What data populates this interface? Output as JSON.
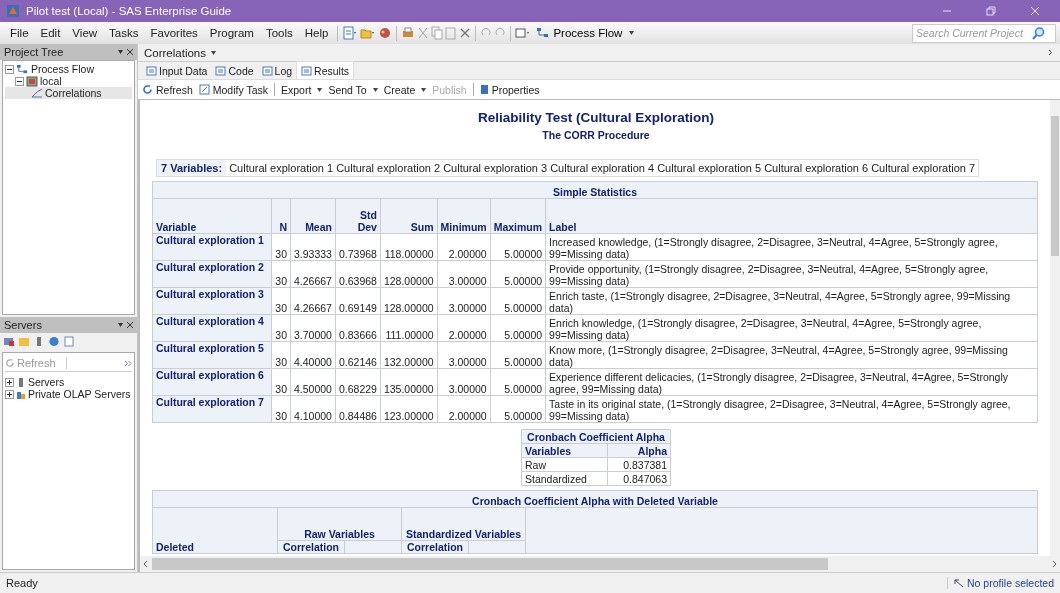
{
  "window": {
    "title": "Pilot test (Local) - SAS Enterprise Guide"
  },
  "menu": [
    "File",
    "Edit",
    "View",
    "Tasks",
    "Favorites",
    "Program",
    "Tools",
    "Help"
  ],
  "process_flow_button": "Process Flow",
  "search": {
    "placeholder": "Search Current Project"
  },
  "project_tree": {
    "title": "Project Tree",
    "items": [
      {
        "label": "Process Flow",
        "kind": "flow",
        "children": [
          {
            "label": "local",
            "kind": "server",
            "children": [
              {
                "label": "Correlations",
                "kind": "task",
                "selected": true
              }
            ]
          }
        ]
      }
    ]
  },
  "servers": {
    "title": "Servers",
    "refresh": "Refresh",
    "items": [
      {
        "label": "Servers",
        "kind": "server"
      },
      {
        "label": "Private OLAP Servers",
        "kind": "olap"
      }
    ]
  },
  "document": {
    "title": "Correlations",
    "tabs": [
      {
        "label": "Input Data",
        "selected": false
      },
      {
        "label": "Code",
        "selected": false
      },
      {
        "label": "Log",
        "selected": false
      },
      {
        "label": "Results",
        "selected": true
      }
    ],
    "actions": [
      {
        "label": "Refresh",
        "kind": "refresh",
        "dropdown": false,
        "disabled": false
      },
      {
        "label": "Modify Task",
        "kind": "modify",
        "dropdown": false,
        "disabled": false
      },
      {
        "label": "Export",
        "kind": "text",
        "dropdown": true,
        "disabled": false
      },
      {
        "label": "Send To",
        "kind": "text",
        "dropdown": true,
        "disabled": false
      },
      {
        "label": "Create",
        "kind": "text",
        "dropdown": true,
        "disabled": false
      },
      {
        "label": "Publish",
        "kind": "text",
        "dropdown": false,
        "disabled": true
      },
      {
        "label": "Properties",
        "kind": "properties",
        "dropdown": false,
        "disabled": false
      }
    ]
  },
  "report": {
    "title": "Reliability Test (Cultural Exploration)",
    "subtitle": "The CORR Procedure",
    "variables_label": "7 Variables:",
    "variables": "Cultural exploration 1 Cultural exploration 2 Cultural exploration 3 Cultural exploration 4 Cultural exploration 5 Cultural exploration 6 Cultural exploration 7",
    "simple_statistics": {
      "title": "Simple Statistics",
      "columns": [
        "Variable",
        "N",
        "Mean",
        "Std Dev",
        "Sum",
        "Minimum",
        "Maximum",
        "Label"
      ],
      "rows": [
        [
          "Cultural exploration 1",
          "30",
          "3.93333",
          "0.73968",
          "118.00000",
          "2.00000",
          "5.00000",
          "Increased knowledge, (1=Strongly disagree, 2=Disagree, 3=Neutral, 4=Agree, 5=Strongly agree, 99=Missing data)"
        ],
        [
          "Cultural exploration 2",
          "30",
          "4.26667",
          "0.63968",
          "128.00000",
          "3.00000",
          "5.00000",
          "Provide opportunity, (1=Strongly disagree, 2=Disagree, 3=Neutral, 4=Agree, 5=Strongly agree, 99=Missing data)"
        ],
        [
          "Cultural exploration 3",
          "30",
          "4.26667",
          "0.69149",
          "128.00000",
          "3.00000",
          "5.00000",
          "Enrich taste, (1=Strongly disagree, 2=Disagree, 3=Neutral, 4=Agree, 5=Strongly agree, 99=Missing data)"
        ],
        [
          "Cultural exploration 4",
          "30",
          "3.70000",
          "0.83666",
          "111.00000",
          "2.00000",
          "5.00000",
          "Enrich knowledge, (1=Strongly disagree, 2=Disagree, 3=Neutral, 4=Agree, 5=Strongly agree, 99=Missing data)"
        ],
        [
          "Cultural exploration 5",
          "30",
          "4.40000",
          "0.62146",
          "132.00000",
          "3.00000",
          "5.00000",
          "Know more, (1=Strongly disagree, 2=Disagree, 3=Neutral, 4=Agree, 5=Strongly agree, 99=Missing data)"
        ],
        [
          "Cultural exploration 6",
          "30",
          "4.50000",
          "0.68229",
          "135.00000",
          "3.00000",
          "5.00000",
          "Experience different delicacies, (1=Strongly disagree, 2=Disagree, 3=Neutral, 4=Agree, 5=Strongly agree, 99=Missing data)"
        ],
        [
          "Cultural exploration 7",
          "30",
          "4.10000",
          "0.84486",
          "123.00000",
          "2.00000",
          "5.00000",
          "Taste in its original state, (1=Strongly disagree, 2=Disagree, 3=Neutral, 4=Agree, 5=Strongly agree, 99=Missing data)"
        ]
      ]
    },
    "alpha": {
      "title": "Cronbach Coefficient Alpha",
      "columns": [
        "Variables",
        "Alpha"
      ],
      "rows": [
        [
          "Raw",
          "0.837381"
        ],
        [
          "Standardized",
          "0.847063"
        ]
      ]
    },
    "deleted": {
      "title": "Cronbach Coefficient Alpha with Deleted Variable",
      "row_header": "Deleted",
      "groups": [
        "Raw Variables",
        "Standardized Variables"
      ],
      "subheaders": [
        "Correlation",
        "Correlation"
      ]
    }
  },
  "status_bar": {
    "text": "Ready",
    "profile": "No profile selected"
  }
}
